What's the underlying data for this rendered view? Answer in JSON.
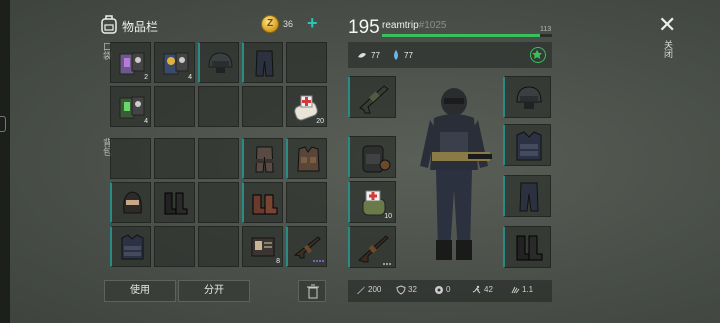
{
  "inventory": {
    "title": "物品栏",
    "coins": "36",
    "plus": "+",
    "pocket_label": "口袋",
    "backpack_label": "背包",
    "use_button": "使用",
    "split_button": "分开"
  },
  "items": {
    "card_a_count": "2",
    "card_b_count": "4",
    "card_c_count": "4",
    "medkit_count": "20",
    "id_card_count": "8"
  },
  "character": {
    "level": "195",
    "name": "reamtrip",
    "id": "#1025",
    "xp_max": "113",
    "xp_fraction": 0.93,
    "hunger": "77",
    "thirst": "77",
    "bandage_count": "10"
  },
  "close": {
    "label": "关闭",
    "symbol": "✕"
  },
  "stats": {
    "damage": "200",
    "defense": "32",
    "poison": "0",
    "speed": "42",
    "stealth": "1.1"
  },
  "colors": {
    "accent": "#2a8a84",
    "xp": "#39c05a",
    "plus": "#2ec4b6"
  }
}
